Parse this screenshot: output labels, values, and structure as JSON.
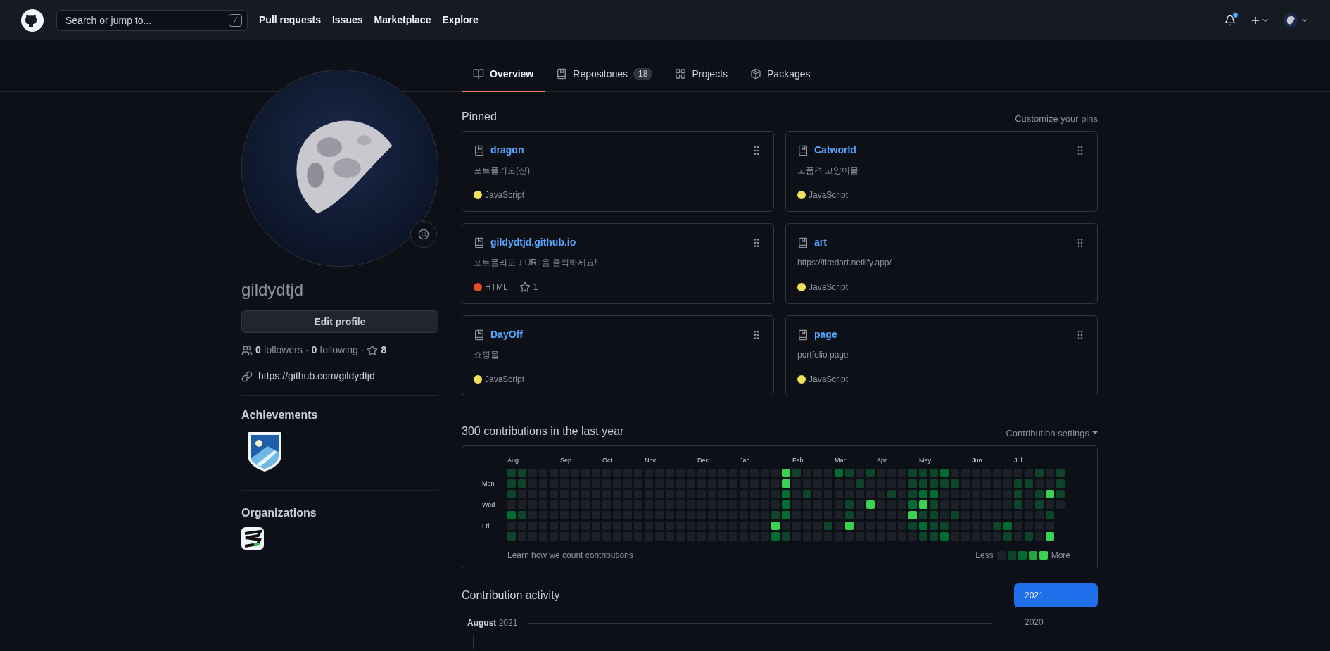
{
  "header": {
    "search": {
      "placeholder": "Search or jump to...",
      "shortcut": "/"
    },
    "nav": [
      "Pull requests",
      "Issues",
      "Marketplace",
      "Explore"
    ],
    "notifications": {
      "unread": true
    }
  },
  "tabs": [
    {
      "label": "Overview",
      "selected": true,
      "kind": "overview"
    },
    {
      "label": "Repositories",
      "count": "18",
      "selected": false,
      "kind": "repo"
    },
    {
      "label": "Projects",
      "selected": false,
      "kind": "projects"
    },
    {
      "label": "Packages",
      "selected": false,
      "kind": "packages"
    }
  ],
  "profile": {
    "username": "gildydtjd",
    "edit_button": "Edit profile",
    "followers": "**0** followers",
    "separator_1": "·",
    "following": "**0** following",
    "separator_2": "·",
    "stars": "8",
    "website": "https://github.com/gildydtjd",
    "achievements_title": "Achievements",
    "organizations_title": "Organizations"
  },
  "pinned": {
    "title": "Pinned",
    "action": "Customize your pins",
    "repos": [
      {
        "name": "dragon",
        "description": "포트폴리오(신)",
        "language": "JavaScript",
        "color": "#f1e05a"
      },
      {
        "name": "Catworld",
        "description": "고품격 고양이몰",
        "language": "JavaScript",
        "color": "#f1e05a"
      },
      {
        "name": "gildydtjd.github.io",
        "description": "포트폴리오 ↓ URL을 클릭하세요!",
        "language": "HTML",
        "color": "#e34c26",
        "stars": "1"
      },
      {
        "name": "art",
        "description": "https://tiredart.netlify.app/",
        "language": "JavaScript",
        "color": "#f1e05a"
      },
      {
        "name": "DayOff",
        "description": "쇼핑몰",
        "language": "JavaScript",
        "color": "#f1e05a"
      },
      {
        "name": "page",
        "description": "portfolio page",
        "language": "JavaScript",
        "color": "#f1e05a"
      }
    ]
  },
  "contributions": {
    "title": "300 contributions in the last year",
    "settings": "Contribution settings",
    "months": [
      "Aug",
      "Sep",
      "Oct",
      "Nov",
      "Dec",
      "Jan",
      "Feb",
      "Mar",
      "Apr",
      "May",
      "Jun",
      "Jul"
    ],
    "day_labels": [
      "Mon",
      "Wed",
      "Fri"
    ],
    "grid": [
      {
        "cells": [
          {
            "color": "#0e4429"
          },
          {
            "color": "#0e4429"
          },
          {
            "color": "#1c2128"
          },
          {
            "color": "#1c2128"
          },
          {
            "color": "#1c2128"
          },
          {
            "color": "#1c2128"
          },
          {
            "color": "#1c2128"
          },
          {
            "color": "#1c2128"
          },
          {
            "color": "#1c2128"
          },
          {
            "color": "#1c2128"
          },
          {
            "color": "#1c2128"
          },
          {
            "color": "#1c2128"
          },
          {
            "color": "#1c2128"
          },
          {
            "color": "#1c2128"
          },
          {
            "color": "#1c2128"
          },
          {
            "color": "#1c2128"
          },
          {
            "color": "#1c2128"
          },
          {
            "color": "#1c2128"
          },
          {
            "color": "#1c2128"
          },
          {
            "color": "#1c2128"
          },
          {
            "color": "#1c2128"
          },
          {
            "color": "#1c2128"
          },
          {
            "color": "#1c2128"
          },
          {
            "color": "#1c2128"
          },
          {
            "color": "#1c2128"
          },
          {
            "color": "#1c2128"
          },
          {
            "color": "#39d353"
          },
          {
            "color": "#0e4429"
          },
          {
            "color": "#1c2128"
          },
          {
            "color": "#1c2128"
          },
          {
            "color": "#1c2128"
          },
          {
            "color": "#006d32"
          },
          {
            "color": "#0e4429"
          },
          {
            "color": "#1c2128"
          },
          {
            "color": "#0e4429"
          },
          {
            "color": "#1c2128"
          },
          {
            "color": "#1c2128"
          },
          {
            "color": "#1c2128"
          },
          {
            "color": "#0e4429"
          },
          {
            "color": "#0e4429"
          },
          {
            "color": "#0e4429"
          },
          {
            "color": "#006d32"
          },
          {
            "color": "#1c2128"
          },
          {
            "color": "#1c2128"
          },
          {
            "color": "#1c2128"
          },
          {
            "color": "#1c2128"
          },
          {
            "color": "#1c2128"
          },
          {
            "color": "#1c2128"
          },
          {
            "color": "#1c2128"
          },
          {
            "color": "#1c2128"
          },
          {
            "color": "#0e4429"
          },
          {
            "color": "#1c2128"
          },
          {
            "color": "#0e4429"
          }
        ]
      },
      {
        "cells": [
          {
            "color": "#0e4429"
          },
          {
            "color": "#0e4429"
          },
          {
            "color": "#1c2128"
          },
          {
            "color": "#1c2128"
          },
          {
            "color": "#1c2128"
          },
          {
            "color": "#1c2128"
          },
          {
            "color": "#1c2128"
          },
          {
            "color": "#1c2128"
          },
          {
            "color": "#1c2128"
          },
          {
            "color": "#1c2128"
          },
          {
            "color": "#1c2128"
          },
          {
            "color": "#1c2128"
          },
          {
            "color": "#1c2128"
          },
          {
            "color": "#1c2128"
          },
          {
            "color": "#1c2128"
          },
          {
            "color": "#1c2128"
          },
          {
            "color": "#1c2128"
          },
          {
            "color": "#1c2128"
          },
          {
            "color": "#1c2128"
          },
          {
            "color": "#1c2128"
          },
          {
            "color": "#1c2128"
          },
          {
            "color": "#1c2128"
          },
          {
            "color": "#1c2128"
          },
          {
            "color": "#1c2128"
          },
          {
            "color": "#1c2128"
          },
          {
            "color": "#1c2128"
          },
          {
            "color": "#39d353"
          },
          {
            "color": "#1c2128"
          },
          {
            "color": "#1c2128"
          },
          {
            "color": "#1c2128"
          },
          {
            "color": "#1c2128"
          },
          {
            "color": "#1c2128"
          },
          {
            "color": "#1c2128"
          },
          {
            "color": "#0e4429"
          },
          {
            "color": "#1c2128"
          },
          {
            "color": "#1c2128"
          },
          {
            "color": "#1c2128"
          },
          {
            "color": "#1c2128"
          },
          {
            "color": "#0e4429"
          },
          {
            "color": "#0e4429"
          },
          {
            "color": "#0e4429"
          },
          {
            "color": "#0e4429"
          },
          {
            "color": "#0e4429"
          },
          {
            "color": "#1c2128"
          },
          {
            "color": "#1c2128"
          },
          {
            "color": "#1c2128"
          },
          {
            "color": "#1c2128"
          },
          {
            "color": "#1c2128"
          },
          {
            "color": "#0e4429"
          },
          {
            "color": "#0e4429"
          },
          {
            "color": "#1c2128"
          },
          {
            "color": "#1c2128"
          },
          {
            "color": "#0e4429"
          }
        ]
      },
      {
        "cells": [
          {
            "color": "#0e4429"
          },
          {
            "color": "#1c2128"
          },
          {
            "color": "#1c2128"
          },
          {
            "color": "#1c2128"
          },
          {
            "color": "#1c2128"
          },
          {
            "color": "#1c2128"
          },
          {
            "color": "#1c2128"
          },
          {
            "color": "#1c2128"
          },
          {
            "color": "#1c2128"
          },
          {
            "color": "#1c2128"
          },
          {
            "color": "#1c2128"
          },
          {
            "color": "#1c2128"
          },
          {
            "color": "#1c2128"
          },
          {
            "color": "#1c2128"
          },
          {
            "color": "#1c2128"
          },
          {
            "color": "#1c2128"
          },
          {
            "color": "#1c2128"
          },
          {
            "color": "#1c2128"
          },
          {
            "color": "#1c2128"
          },
          {
            "color": "#1c2128"
          },
          {
            "color": "#1c2128"
          },
          {
            "color": "#1c2128"
          },
          {
            "color": "#1c2128"
          },
          {
            "color": "#1c2128"
          },
          {
            "color": "#1c2128"
          },
          {
            "color": "#1c2128"
          },
          {
            "color": "#006d32"
          },
          {
            "color": "#1c2128"
          },
          {
            "color": "#0e4429"
          },
          {
            "color": "#1c2128"
          },
          {
            "color": "#1c2128"
          },
          {
            "color": "#1c2128"
          },
          {
            "color": "#1c2128"
          },
          {
            "color": "#1c2128"
          },
          {
            "color": "#1c2128"
          },
          {
            "color": "#1c2128"
          },
          {
            "color": "#0e4429"
          },
          {
            "color": "#1c2128"
          },
          {
            "color": "#0e4429"
          },
          {
            "color": "#006d32"
          },
          {
            "color": "#006d32"
          },
          {
            "color": "#1c2128"
          },
          {
            "color": "#1c2128"
          },
          {
            "color": "#1c2128"
          },
          {
            "color": "#1c2128"
          },
          {
            "color": "#1c2128"
          },
          {
            "color": "#1c2128"
          },
          {
            "color": "#1c2128"
          },
          {
            "color": "#0e4429"
          },
          {
            "color": "#1c2128"
          },
          {
            "color": "#0e4429"
          },
          {
            "color": "#39d353"
          },
          {
            "color": "#0e4429"
          }
        ]
      },
      {
        "cells": [
          {
            "color": "#1c2128"
          },
          {
            "color": "#1c2128"
          },
          {
            "color": "#1c2128"
          },
          {
            "color": "#1c2128"
          },
          {
            "color": "#1c2128"
          },
          {
            "color": "#1c2128"
          },
          {
            "color": "#1c2128"
          },
          {
            "color": "#1c2128"
          },
          {
            "color": "#1c2128"
          },
          {
            "color": "#1c2128"
          },
          {
            "color": "#1c2128"
          },
          {
            "color": "#1c2128"
          },
          {
            "color": "#1c2128"
          },
          {
            "color": "#1c2128"
          },
          {
            "color": "#1c2128"
          },
          {
            "color": "#1c2128"
          },
          {
            "color": "#1c2128"
          },
          {
            "color": "#1c2128"
          },
          {
            "color": "#1c2128"
          },
          {
            "color": "#1c2128"
          },
          {
            "color": "#1c2128"
          },
          {
            "color": "#1c2128"
          },
          {
            "color": "#1c2128"
          },
          {
            "color": "#1c2128"
          },
          {
            "color": "#1c2128"
          },
          {
            "color": "#1c2128"
          },
          {
            "color": "#006d32"
          },
          {
            "color": "#1c2128"
          },
          {
            "color": "#1c2128"
          },
          {
            "color": "#1c2128"
          },
          {
            "color": "#1c2128"
          },
          {
            "color": "#1c2128"
          },
          {
            "color": "#0e4429"
          },
          {
            "color": "#1c2128"
          },
          {
            "color": "#39d353"
          },
          {
            "color": "#1c2128"
          },
          {
            "color": "#1c2128"
          },
          {
            "color": "#1c2128"
          },
          {
            "color": "#006d32"
          },
          {
            "color": "#39d353"
          },
          {
            "color": "#0e4429"
          },
          {
            "color": "#1c2128"
          },
          {
            "color": "#1c2128"
          },
          {
            "color": "#1c2128"
          },
          {
            "color": "#1c2128"
          },
          {
            "color": "#1c2128"
          },
          {
            "color": "#1c2128"
          },
          {
            "color": "#1c2128"
          },
          {
            "color": "#0e4429"
          },
          {
            "color": "#1c2128"
          },
          {
            "color": "#0e4429"
          },
          {
            "color": "#1c2128"
          },
          {
            "color": "#1c2128"
          }
        ]
      },
      {
        "cells": [
          {
            "color": "#006d32"
          },
          {
            "color": "#0e4429"
          },
          {
            "color": "#1c2128"
          },
          {
            "color": "#1c2128"
          },
          {
            "color": "#1c2128"
          },
          {
            "color": "#1c2128"
          },
          {
            "color": "#1c2128"
          },
          {
            "color": "#1c2128"
          },
          {
            "color": "#1c2128"
          },
          {
            "color": "#1c2128"
          },
          {
            "color": "#1c2128"
          },
          {
            "color": "#1c2128"
          },
          {
            "color": "#1c2128"
          },
          {
            "color": "#1c2128"
          },
          {
            "color": "#1c2128"
          },
          {
            "color": "#1c2128"
          },
          {
            "color": "#1c2128"
          },
          {
            "color": "#1c2128"
          },
          {
            "color": "#1c2128"
          },
          {
            "color": "#1c2128"
          },
          {
            "color": "#1c2128"
          },
          {
            "color": "#1c2128"
          },
          {
            "color": "#1c2128"
          },
          {
            "color": "#1c2128"
          },
          {
            "color": "#1c2128"
          },
          {
            "color": "#0e4429"
          },
          {
            "color": "#006d32"
          },
          {
            "color": "#1c2128"
          },
          {
            "color": "#1c2128"
          },
          {
            "color": "#1c2128"
          },
          {
            "color": "#1c2128"
          },
          {
            "color": "#1c2128"
          },
          {
            "color": "#0e4429"
          },
          {
            "color": "#1c2128"
          },
          {
            "color": "#1c2128"
          },
          {
            "color": "#1c2128"
          },
          {
            "color": "#1c2128"
          },
          {
            "color": "#1c2128"
          },
          {
            "color": "#39d353"
          },
          {
            "color": "#0e4429"
          },
          {
            "color": "#0e4429"
          },
          {
            "color": "#1c2128"
          },
          {
            "color": "#0e4429"
          },
          {
            "color": "#1c2128"
          },
          {
            "color": "#1c2128"
          },
          {
            "color": "#1c2128"
          },
          {
            "color": "#1c2128"
          },
          {
            "color": "#1c2128"
          },
          {
            "color": "#1c2128"
          },
          {
            "color": "#1c2128"
          },
          {
            "color": "#1c2128"
          },
          {
            "color": "#0e4429"
          }
        ]
      },
      {
        "cells": [
          {
            "color": "#1c2128"
          },
          {
            "color": "#1c2128"
          },
          {
            "color": "#1c2128"
          },
          {
            "color": "#1c2128"
          },
          {
            "color": "#1c2128"
          },
          {
            "color": "#1c2128"
          },
          {
            "color": "#1c2128"
          },
          {
            "color": "#1c2128"
          },
          {
            "color": "#1c2128"
          },
          {
            "color": "#1c2128"
          },
          {
            "color": "#1c2128"
          },
          {
            "color": "#1c2128"
          },
          {
            "color": "#1c2128"
          },
          {
            "color": "#1c2128"
          },
          {
            "color": "#1c2128"
          },
          {
            "color": "#1c2128"
          },
          {
            "color": "#1c2128"
          },
          {
            "color": "#1c2128"
          },
          {
            "color": "#1c2128"
          },
          {
            "color": "#1c2128"
          },
          {
            "color": "#1c2128"
          },
          {
            "color": "#1c2128"
          },
          {
            "color": "#1c2128"
          },
          {
            "color": "#1c2128"
          },
          {
            "color": "#1c2128"
          },
          {
            "color": "#39d353"
          },
          {
            "color": "#1c2128"
          },
          {
            "color": "#1c2128"
          },
          {
            "color": "#1c2128"
          },
          {
            "color": "#1c2128"
          },
          {
            "color": "#0e4429"
          },
          {
            "color": "#1c2128"
          },
          {
            "color": "#39d353"
          },
          {
            "color": "#1c2128"
          },
          {
            "color": "#1c2128"
          },
          {
            "color": "#1c2128"
          },
          {
            "color": "#1c2128"
          },
          {
            "color": "#1c2128"
          },
          {
            "color": "#0e4429"
          },
          {
            "color": "#006d32"
          },
          {
            "color": "#0e4429"
          },
          {
            "color": "#0e4429"
          },
          {
            "color": "#1c2128"
          },
          {
            "color": "#1c2128"
          },
          {
            "color": "#1c2128"
          },
          {
            "color": "#1c2128"
          },
          {
            "color": "#0e4429"
          },
          {
            "color": "#006d32"
          },
          {
            "color": "#1c2128"
          },
          {
            "color": "#1c2128"
          },
          {
            "color": "#1c2128"
          },
          {
            "color": "#1c2128"
          }
        ]
      },
      {
        "cells": [
          {
            "color": "#0e4429"
          },
          {
            "color": "#1c2128"
          },
          {
            "color": "#1c2128"
          },
          {
            "color": "#1c2128"
          },
          {
            "color": "#1c2128"
          },
          {
            "color": "#1c2128"
          },
          {
            "color": "#1c2128"
          },
          {
            "color": "#1c2128"
          },
          {
            "color": "#1c2128"
          },
          {
            "color": "#1c2128"
          },
          {
            "color": "#1c2128"
          },
          {
            "color": "#1c2128"
          },
          {
            "color": "#1c2128"
          },
          {
            "color": "#1c2128"
          },
          {
            "color": "#1c2128"
          },
          {
            "color": "#1c2128"
          },
          {
            "color": "#1c2128"
          },
          {
            "color": "#1c2128"
          },
          {
            "color": "#1c2128"
          },
          {
            "color": "#1c2128"
          },
          {
            "color": "#1c2128"
          },
          {
            "color": "#1c2128"
          },
          {
            "color": "#1c2128"
          },
          {
            "color": "#1c2128"
          },
          {
            "color": "#1c2128"
          },
          {
            "color": "#006d32"
          },
          {
            "color": "#0e4429"
          },
          {
            "color": "#1c2128"
          },
          {
            "color": "#1c2128"
          },
          {
            "color": "#1c2128"
          },
          {
            "color": "#1c2128"
          },
          {
            "color": "#1c2128"
          },
          {
            "color": "#1c2128"
          },
          {
            "color": "#1c2128"
          },
          {
            "color": "#1c2128"
          },
          {
            "color": "#1c2128"
          },
          {
            "color": "#1c2128"
          },
          {
            "color": "#1c2128"
          },
          {
            "color": "#1c2128"
          },
          {
            "color": "#0e4429"
          },
          {
            "color": "#0e4429"
          },
          {
            "color": "#006d32"
          },
          {
            "color": "#1c2128"
          },
          {
            "color": "#1c2128"
          },
          {
            "color": "#1c2128"
          },
          {
            "color": "#1c2128"
          },
          {
            "color": "#1c2128"
          },
          {
            "color": "#0e4429"
          },
          {
            "color": "#1c2128"
          },
          {
            "color": "#0e4429"
          },
          {
            "color": "#1c2128"
          },
          {
            "color": "#39d353"
          }
        ]
      }
    ],
    "footer": "Learn how we count contributions",
    "less": "Less",
    "more": "More",
    "legend": [
      {
        "color": "#1c2128"
      },
      {
        "color": "#0e4429"
      },
      {
        "color": "#006d32"
      },
      {
        "color": "#26a641"
      },
      {
        "color": "#39d353"
      }
    ]
  },
  "activity": {
    "title": "Contribution activity",
    "month": "**August** 2021",
    "years": [
      {
        "label": "2021",
        "selected": true
      },
      {
        "label": "2020",
        "selected": false
      }
    ]
  }
}
